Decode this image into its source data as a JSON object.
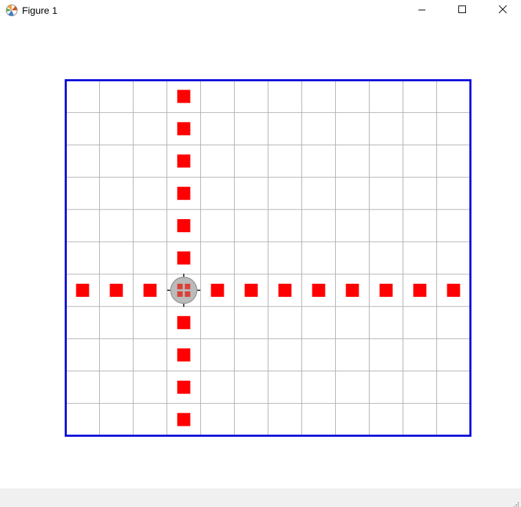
{
  "window": {
    "title": "Figure 1",
    "icons": {
      "app": "matplotlib-figure-icon",
      "minimize": "minimize-icon",
      "maximize": "maximize-icon",
      "close": "close-icon"
    }
  },
  "chart_data": {
    "type": "scatter",
    "grid": true,
    "grid_cols": 12,
    "grid_rows": 11,
    "frame_color": "#0000dd",
    "grid_color": "#b0b0b0",
    "marker_color": "#ff0000",
    "marker_shape": "square",
    "cursor_color": "#bbbbbb",
    "cursor": {
      "col": 3,
      "row": 6
    },
    "series": [
      {
        "points": [
          {
            "col": 3,
            "row": 0
          },
          {
            "col": 3,
            "row": 1
          },
          {
            "col": 3,
            "row": 2
          },
          {
            "col": 3,
            "row": 3
          },
          {
            "col": 3,
            "row": 4
          },
          {
            "col": 3,
            "row": 5
          },
          {
            "col": 3,
            "row": 7
          },
          {
            "col": 3,
            "row": 8
          },
          {
            "col": 3,
            "row": 9
          },
          {
            "col": 3,
            "row": 10
          },
          {
            "col": 0,
            "row": 6
          },
          {
            "col": 1,
            "row": 6
          },
          {
            "col": 2,
            "row": 6
          },
          {
            "col": 4,
            "row": 6
          },
          {
            "col": 5,
            "row": 6
          },
          {
            "col": 6,
            "row": 6
          },
          {
            "col": 7,
            "row": 6
          },
          {
            "col": 8,
            "row": 6
          },
          {
            "col": 9,
            "row": 6
          },
          {
            "col": 10,
            "row": 6
          },
          {
            "col": 11,
            "row": 6
          }
        ]
      }
    ]
  }
}
